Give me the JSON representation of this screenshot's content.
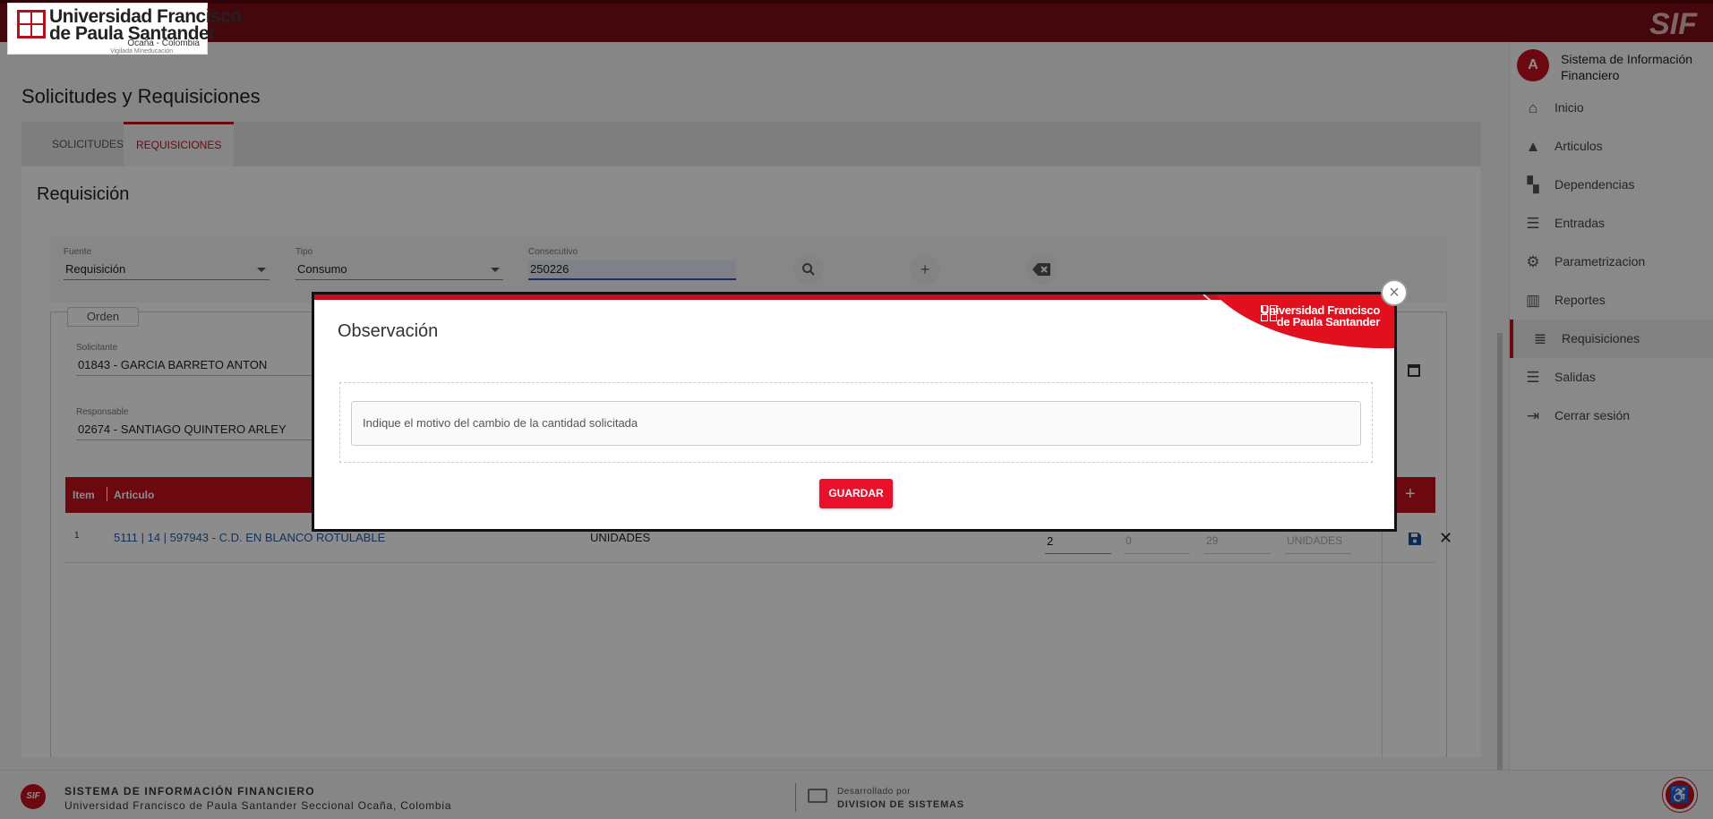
{
  "header": {
    "logo_line1": "Universidad Francisco",
    "logo_line2": "de Paula Santander",
    "logo_line3": "Ocaña - Colombia",
    "logo_line4": "Vigilada Mineducación",
    "app_badge": "SIF"
  },
  "page": {
    "title": "Solicitudes y Requisiciones",
    "tabs": [
      {
        "label": "SOLICITUDES",
        "active": false
      },
      {
        "label": "REQUISICIONES",
        "active": true
      }
    ]
  },
  "requisicion": {
    "title": "Requisición",
    "fuente": {
      "label": "Fuente",
      "value": "Requisición"
    },
    "tipo": {
      "label": "Tipo",
      "value": "Consumo"
    },
    "consecutivo": {
      "label": "Consecutivo",
      "value": "250226"
    },
    "search_icon": "search-icon",
    "add_icon": "plus-icon",
    "clear_icon": "backspace-icon",
    "orden_label": "Orden",
    "solicitante": {
      "label": "Solicitante",
      "value": "01843 - GARCIA BARRETO ANTON"
    },
    "responsable": {
      "label": "Responsable",
      "value": "02674 - SANTIAGO QUINTERO ARLEY"
    },
    "table": {
      "headers": [
        "Item",
        "Articulo"
      ],
      "rows": [
        {
          "item": "1",
          "articulo": "5111 | 14 | 597943 - C.D. EN BLANCO ROTULABLE",
          "unidad": "UNIDADES",
          "cantidad": "2",
          "q2": "0",
          "q3": "29",
          "q4": "UNIDADES"
        }
      ]
    }
  },
  "sidebar": {
    "avatar": "A",
    "system_name": "Sistema de Información Financiero",
    "items": [
      {
        "label": "Inicio",
        "icon": "home-icon",
        "glyph": "⌂",
        "active": false
      },
      {
        "label": "Articulos",
        "icon": "shapes-icon",
        "glyph": "▲",
        "active": false
      },
      {
        "label": "Dependencias",
        "icon": "hierarchy-icon",
        "glyph": "▚",
        "active": false
      },
      {
        "label": "Entradas",
        "icon": "indent-icon",
        "glyph": "☰",
        "active": false
      },
      {
        "label": "Parametrizacion",
        "icon": "gear-icon",
        "glyph": "⚙",
        "active": false
      },
      {
        "label": "Reportes",
        "icon": "bar-chart-icon",
        "glyph": "▥",
        "active": false
      },
      {
        "label": "Requisiciones",
        "icon": "list-icon",
        "glyph": "≣",
        "active": true
      },
      {
        "label": "Salidas",
        "icon": "outdent-icon",
        "glyph": "☰",
        "active": false
      },
      {
        "label": "Cerrar sesión",
        "icon": "logout-icon",
        "glyph": "⇥",
        "active": false
      }
    ]
  },
  "footer": {
    "title": "SISTEMA DE INFORMACIÓN FINANCIERO",
    "subtitle": "Universidad Francisco de Paula Santander Seccional Ocaña, Colombia",
    "dev_label": "Desarrollado por",
    "dev_name": "DIVISION DE SISTEMAS",
    "logo_text": "SIF"
  },
  "modal": {
    "title": "Observación",
    "input_placeholder": "Indique el motivo del cambio de la cantidad solicitada",
    "save_label": "GUARDAR",
    "brand_line1": "Universidad Francisco",
    "brand_line2": "de Paula Santander",
    "close_glyph": "×"
  },
  "colors": {
    "brand_red": "#c4101e",
    "topbar_red": "#7d0d16",
    "button_red": "#e8102a"
  }
}
